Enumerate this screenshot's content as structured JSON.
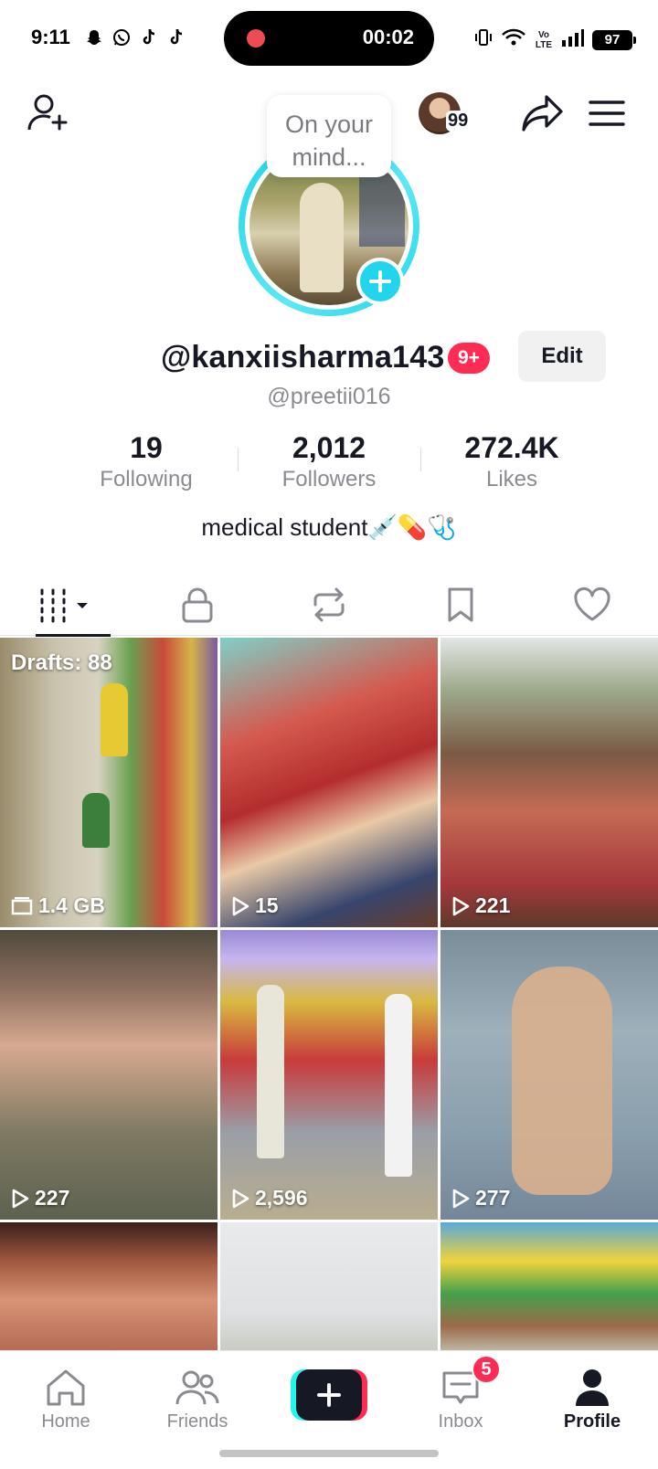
{
  "status_bar": {
    "time": "9:11",
    "recording_time": "00:02",
    "network": "Vo LTE",
    "battery": "97"
  },
  "header": {
    "mini_avatar_count": "99"
  },
  "profile": {
    "mind_prompt": "On your mind...",
    "username": "@kanxiisharma143",
    "notification_badge": "9+",
    "edit_label": "Edit",
    "handle": "@preetii016",
    "bio": "medical student💉💊🩺",
    "stats": [
      {
        "value": "19",
        "label": "Following"
      },
      {
        "value": "2,012",
        "label": "Followers"
      },
      {
        "value": "272.4K",
        "label": "Likes"
      }
    ]
  },
  "tabs": [
    "videos",
    "private",
    "reposts",
    "favorites",
    "liked"
  ],
  "grid": {
    "drafts_label": "Drafts: 88",
    "drafts_size": "1.4 GB",
    "videos": [
      {
        "views": "15"
      },
      {
        "views": "221"
      },
      {
        "views": "227"
      },
      {
        "views": "2,596"
      },
      {
        "views": "277"
      }
    ]
  },
  "bottom_nav": {
    "home": "Home",
    "friends": "Friends",
    "inbox": "Inbox",
    "inbox_badge": "5",
    "profile": "Profile"
  },
  "colors": {
    "accent_pink": "#fe2c55",
    "accent_cyan": "#20d5ec",
    "text_primary": "#161823",
    "text_secondary": "#8a8b91"
  }
}
